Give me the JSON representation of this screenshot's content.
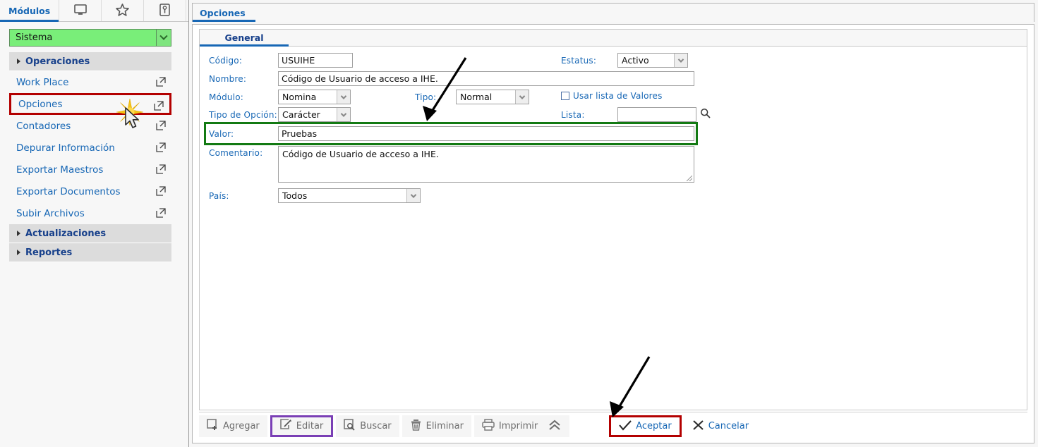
{
  "sidebar": {
    "tabs": [
      {
        "label": "Módulos",
        "name": "tab-modulos",
        "active": true
      },
      {
        "label": "",
        "name": "tab-display",
        "icon": "monitor-icon"
      },
      {
        "label": "",
        "name": "tab-favorites",
        "icon": "star-icon"
      },
      {
        "label": "",
        "name": "tab-tools",
        "icon": "wrench-icon"
      }
    ],
    "module_select": {
      "value": "Sistema",
      "accent": "#79ee79"
    },
    "groups": [
      {
        "label": "Operaciones",
        "expanded": true
      },
      {
        "label": "Actualizaciones",
        "expanded": false
      },
      {
        "label": "Reportes",
        "expanded": false
      }
    ],
    "items": [
      {
        "label": "Work Place",
        "icon": "external-link-icon"
      },
      {
        "label": "Opciones",
        "icon": "external-link-icon",
        "highlighted": true
      },
      {
        "label": "Contadores",
        "icon": "external-link-icon"
      },
      {
        "label": "Depurar Información",
        "icon": "external-link-icon"
      },
      {
        "label": "Exportar Maestros",
        "icon": "external-link-icon"
      },
      {
        "label": "Exportar Documentos",
        "icon": "external-link-icon"
      },
      {
        "label": "Subir Archivos",
        "icon": "external-link-icon"
      }
    ]
  },
  "main": {
    "tab_label": "Opciones",
    "subtab_label": "General",
    "fields": {
      "codigo_label": "Código:",
      "codigo_value": "USUIHE",
      "nombre_label": "Nombre:",
      "nombre_value": "Código de Usuario de acceso a IHE.",
      "modulo_label": "Módulo:",
      "modulo_value": "Nomina",
      "tipo_label": "Tipo:",
      "tipo_value": "Normal",
      "tipo_opcion_label": "Tipo de Opción:",
      "tipo_opcion_value": "Carácter",
      "valor_label": "Valor:",
      "valor_value": "Pruebas",
      "comentario_label": "Comentario:",
      "comentario_value": "Código de Usuario de acceso a IHE.",
      "pais_label": "País:",
      "pais_value": "Todos",
      "estatus_label": "Estatus:",
      "estatus_value": "Activo",
      "usar_lista_label": "Usar lista de Valores",
      "usar_lista_checked": false,
      "lista_label": "Lista:",
      "lista_value": ""
    },
    "toolbar": {
      "agregar": "Agregar",
      "editar": "Editar",
      "buscar": "Buscar",
      "eliminar": "Eliminar",
      "imprimir": "Imprimir",
      "aceptar": "Aceptar",
      "cancelar": "Cancelar"
    }
  },
  "annotations": {
    "highlight_red": "#b30000",
    "highlight_green": "#137a13",
    "highlight_purple": "#7a3fb5",
    "arrow_color": "#000000",
    "click_burst_color": "#f5c518"
  }
}
